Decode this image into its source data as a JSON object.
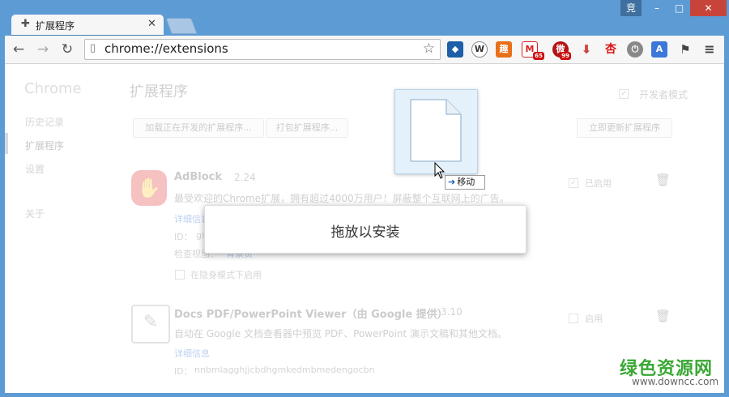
{
  "window": {
    "tab_title": "扩展程序",
    "user_label": "竞",
    "minimize": "–",
    "maximize": "□",
    "close": "✕"
  },
  "toolbar": {
    "url": "chrome://extensions"
  },
  "sidebar": {
    "brand": "Chrome",
    "items": [
      {
        "label": "历史记录"
      },
      {
        "label": "扩展程序"
      },
      {
        "label": "设置"
      },
      {
        "label": "关于"
      }
    ]
  },
  "main": {
    "title": "扩展程序",
    "dev_mode_label": "开发者模式",
    "load_unpacked_label": "加载正在开发的扩展程序...",
    "pack_label": "打包扩展程序...",
    "update_label": "立即更新扩展程序"
  },
  "extensions": [
    {
      "name": "AdBlock",
      "version": "2.24",
      "description": "最受欢迎的Chrome扩展，拥有超过4000万用户！屏蔽整个互联网上的广告。",
      "details_link": "详细信息",
      "id_label": "ID：",
      "id_value": "gi",
      "inspect_label": "检查视图：",
      "inspect_link": "背景页",
      "incognito_label": "在隐身模式下启用",
      "enabled_label": "已启用",
      "enabled": true
    },
    {
      "name": "Docs PDF/PowerPoint Viewer（由 Google 提供）",
      "version": "3.10",
      "description": "自动在 Google 文档查看器中预览 PDF、PowerPoint 演示文稿和其他文档。",
      "details_link": "详细信息",
      "id_label": "ID：",
      "id_value": "nnbmlagghjjcbdhgmkedmbmedengocbn",
      "enabled_label": "启用",
      "enabled": false
    }
  ],
  "overlay": {
    "drop_text": "拖放以安装",
    "move_label": "移动"
  },
  "watermark": {
    "title": "绿色资源网",
    "url": "www.downcc.com"
  }
}
